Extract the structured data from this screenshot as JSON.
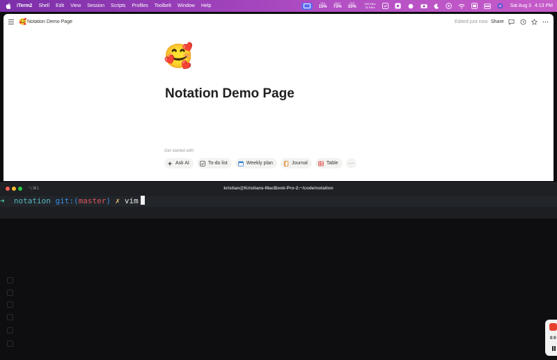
{
  "menubar": {
    "app_name": "iTerm2",
    "menus": [
      "Shell",
      "Edit",
      "View",
      "Session",
      "Scripts",
      "Profiles",
      "Toolbelt",
      "Window",
      "Help"
    ],
    "cpu_label": "CPU",
    "cpu_value": "15%",
    "mem_label": "MEM",
    "mem_value": "73%",
    "ssd_label": "SSD",
    "ssd_value": "33%",
    "net_down": "230 KB/s",
    "net_up": "32 KB/s",
    "date": "Sat Aug 3",
    "time": "4:13 PM"
  },
  "notion": {
    "page_emoji": "🥰",
    "page_title_small": "Notation Demo Page",
    "edited_status": "Edited just now",
    "share_label": "Share",
    "page_title": "Notation Demo Page",
    "get_started_label": "Get started with",
    "templates": [
      {
        "label": "Ask AI",
        "icon": "sparkle-icon"
      },
      {
        "label": "To-do list",
        "icon": "checkbox-icon"
      },
      {
        "label": "Weekly plan",
        "icon": "calendar-icon"
      },
      {
        "label": "Journal",
        "icon": "journal-icon"
      },
      {
        "label": "Table",
        "icon": "table-icon"
      }
    ],
    "more_label": "···"
  },
  "iterm": {
    "shortcut": "⌥⌘1",
    "window_title": "kristian@Kristians-MacBook-Pro-2:~/code/notation",
    "prompt_arrow": "➜",
    "dir": "notation",
    "git_prefix": "git:(",
    "branch": "master",
    "git_suffix": ")",
    "dirty_marker": "✗",
    "command": "vim"
  },
  "recorder": {
    "time": "0:0"
  },
  "colors": {
    "menubar_gradient_start": "#7b2fa8",
    "menubar_gradient_end": "#c65bc9",
    "terminal_bg": "#1c1e21",
    "record_red": "#e8402f"
  }
}
